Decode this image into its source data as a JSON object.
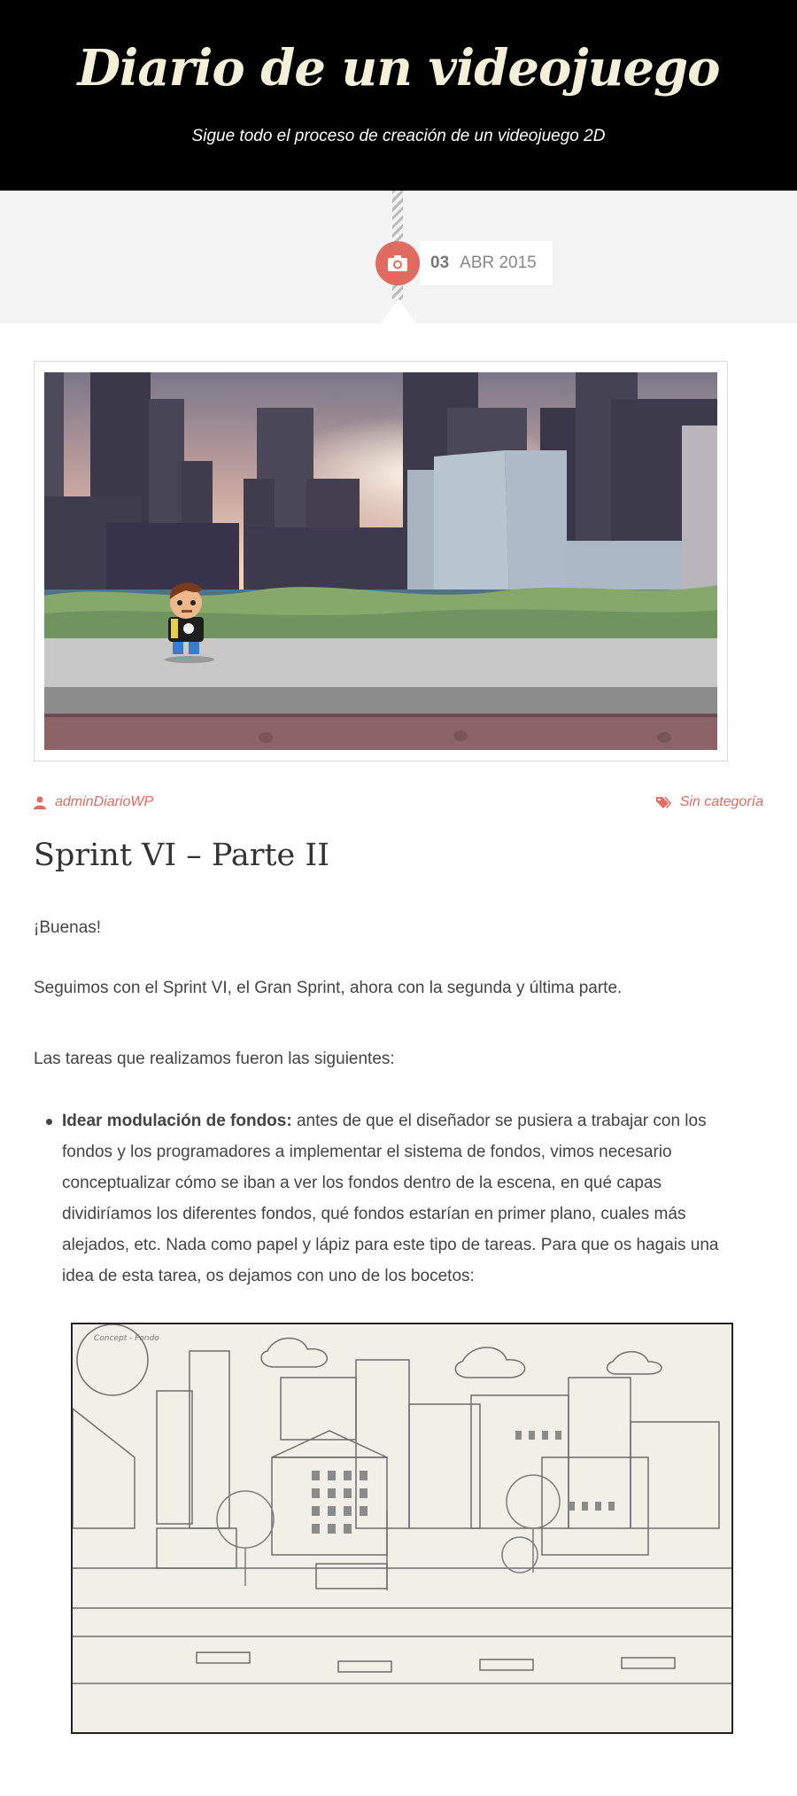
{
  "header": {
    "title": "Diario de un videojuego",
    "tagline": "Sigue todo el proceso de creación de un videojuego 2D"
  },
  "post_date": {
    "icon": "camera-icon",
    "day": "03",
    "month_year": "ABR 2015"
  },
  "post_meta": {
    "author": "adminDiarioWP",
    "author_icon": "user-icon",
    "category": "Sin categoría",
    "category_icon": "tags-icon"
  },
  "post": {
    "title": "Sprint VI – Parte II",
    "paragraphs": [
      "¡Buenas!",
      "Seguimos con el Sprint VI, el Gran Sprint, ahora con la segunda y última parte.",
      "Las tareas que realizamos fueron las siguientes:"
    ],
    "list_items": [
      {
        "bold": "Idear modulación de fondos:",
        "text": " antes de que el diseñador se pusiera a trabajar con los fondos y los programadores a implementar el sistema de fondos, vimos necesario conceptualizar cómo se iban a ver los fondos dentro de la escena, en qué capas dividiríamos los diferentes fondos, qué fondos estarían en primer plano, cuales más alejados, etc. Nada como papel y lápiz para este tipo de tareas. Para que os hagais una idea de esta tarea, os dejamos con uno de los bocetos:"
      }
    ],
    "sketch_label": "Concept - Fondo"
  },
  "colors": {
    "header_bg": "#000000",
    "title_color": "#f4efd8",
    "accent": "#e06b61",
    "band_bg": "#f4f4f4",
    "text": "#444444"
  }
}
